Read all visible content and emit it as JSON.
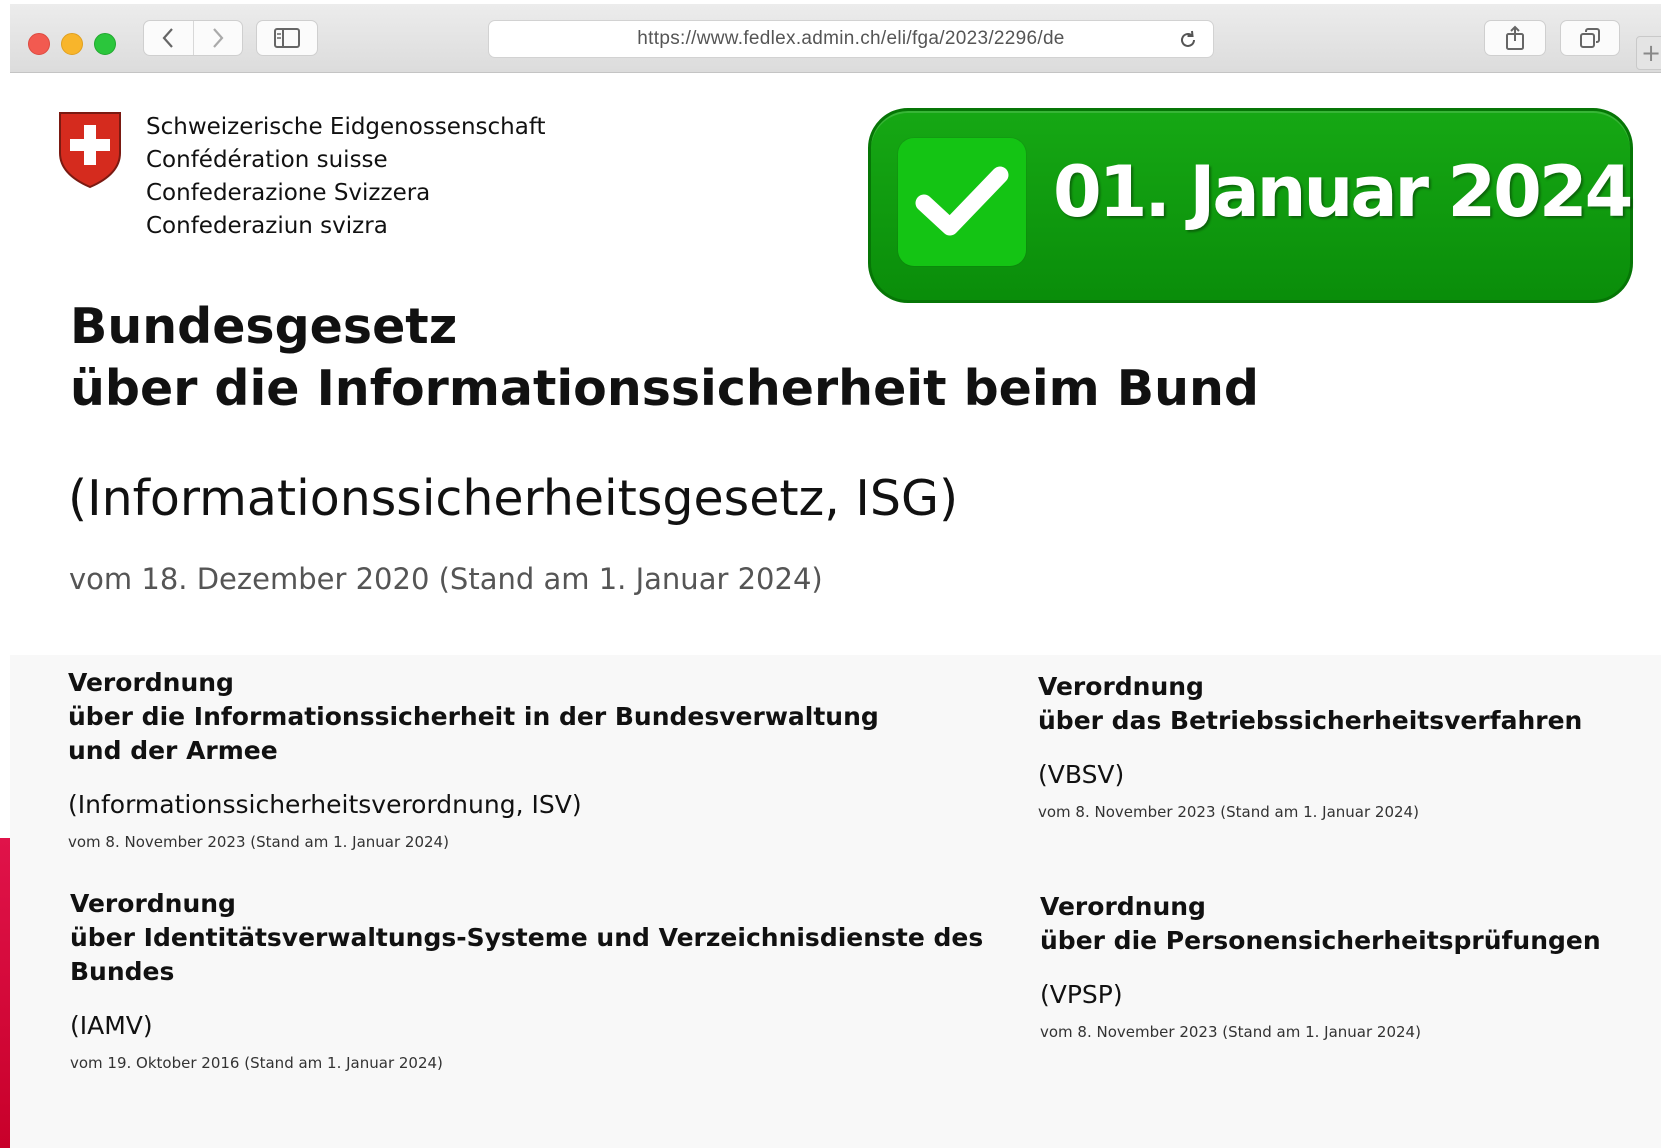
{
  "browser": {
    "url": "https://www.fedlex.admin.ch/eli/fga/2023/2296/de",
    "new_tab_label": "+",
    "icons": [
      "back-icon",
      "forward-icon",
      "sidebar-icon",
      "reload-icon",
      "share-icon",
      "tabs-icon"
    ]
  },
  "header": {
    "confederation_names": [
      "Schweizerische Eidgenossenschaft",
      "Confédération suisse",
      "Confederazione Svizzera",
      "Confederaziun svizra"
    ]
  },
  "badge": {
    "date": "01. Januar 2024",
    "color": "#0f9d0f"
  },
  "document": {
    "title_line1": "Bundesgesetz",
    "title_line2": "über die Informationssicherheit beim Bund",
    "subtitle": "(Informationssicherheitsgesetz, ISG)",
    "date": "vom 18. Dezember 2020 (Stand am 1. Januar 2024)"
  },
  "ordinances": [
    {
      "heading": [
        "Verordnung",
        "über die Informationssicherheit in der Bundesverwaltung",
        "und der Armee"
      ],
      "abbr": "(Informationssicherheitsverordnung, ISV)",
      "date": "vom 8. November 2023 (Stand am 1. Januar 2024)"
    },
    {
      "heading": [
        "Verordnung",
        "über das Betriebssicherheitsverfahren"
      ],
      "abbr": "(VBSV)",
      "date": "vom 8. November 2023 (Stand am 1. Januar 2024)"
    },
    {
      "heading": [
        "Verordnung",
        "über Identitätsverwaltungs-Systeme und Verzeichnisdienste des",
        "Bundes"
      ],
      "abbr": "(IAMV)",
      "date": "vom 19. Oktober 2016 (Stand am 1. Januar 2024)"
    },
    {
      "heading": [
        "Verordnung",
        "über die Personensicherheitsprüfungen"
      ],
      "abbr": "(VPSP)",
      "date": "vom 8. November 2023 (Stand am 1. Januar 2024)"
    }
  ],
  "colors": {
    "swiss_red": "#d52b1e",
    "badge_green": "#0f9d0f",
    "accent_edge": "#dc0f3c"
  }
}
